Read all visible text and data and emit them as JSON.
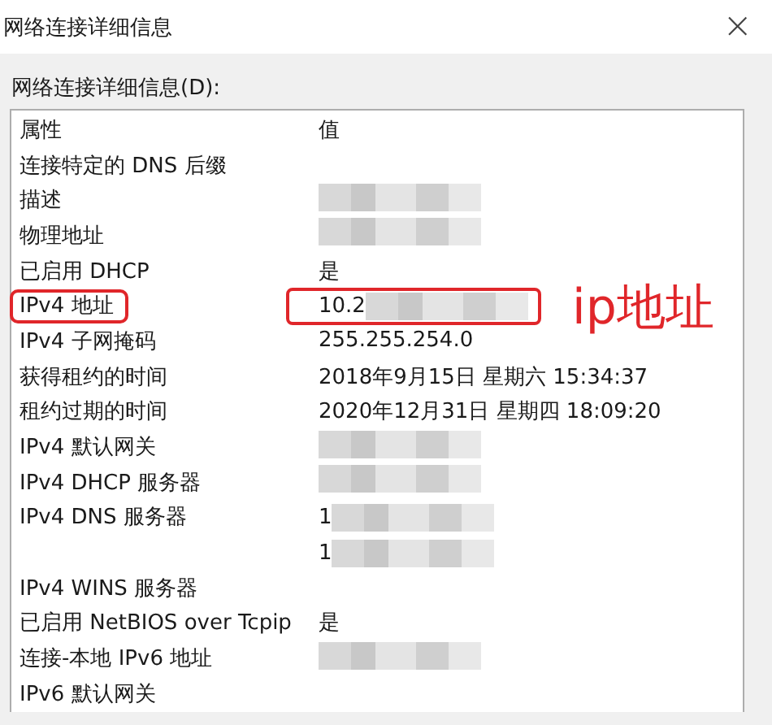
{
  "window": {
    "title": "网络连接详细信息",
    "close": "×"
  },
  "list_label": "网络连接详细信息(D):",
  "table": {
    "columns": [
      "属性",
      "值"
    ],
    "rows": [
      {
        "property": "连接特定的 DNS 后缀",
        "highlighted": false
      },
      {
        "property": "描述",
        "redacted": true,
        "highlighted": false
      },
      {
        "property": "物理地址",
        "redacted": true,
        "highlighted": false
      },
      {
        "property": "已启用 DHCP",
        "value": "是",
        "highlighted": false
      },
      {
        "property": "IPv4 地址",
        "value": "10.2",
        "redacted": true,
        "highlighted": true
      },
      {
        "property": "IPv4 子网掩码",
        "value": "255.255.254.0",
        "highlighted": false
      },
      {
        "property": "获得租约的时间",
        "value": "2018年9月15日 星期六 15:34:37",
        "highlighted": false
      },
      {
        "property": "租约过期的时间",
        "value": "2020年12月31日 星期四 18:09:20",
        "highlighted": false
      },
      {
        "property": "IPv4 默认网关",
        "redacted": true,
        "highlighted": false
      },
      {
        "property": "IPv4 DHCP 服务器",
        "redacted": true,
        "highlighted": false
      },
      {
        "property": "IPv4 DNS 服务器",
        "value": "1",
        "redacted": true,
        "highlighted": false
      },
      {
        "value": "1",
        "redacted": true,
        "highlighted": false
      },
      {
        "property": "IPv4 WINS 服务器",
        "highlighted": false
      },
      {
        "property": "已启用 NetBIOS over Tcpip",
        "value": "是",
        "highlighted": false
      },
      {
        "property": "连接-本地 IPv6 地址",
        "redacted": true,
        "highlighted": false
      },
      {
        "property": "IPv6 默认网关",
        "highlighted": false
      }
    ]
  },
  "annotation": "ip地址"
}
